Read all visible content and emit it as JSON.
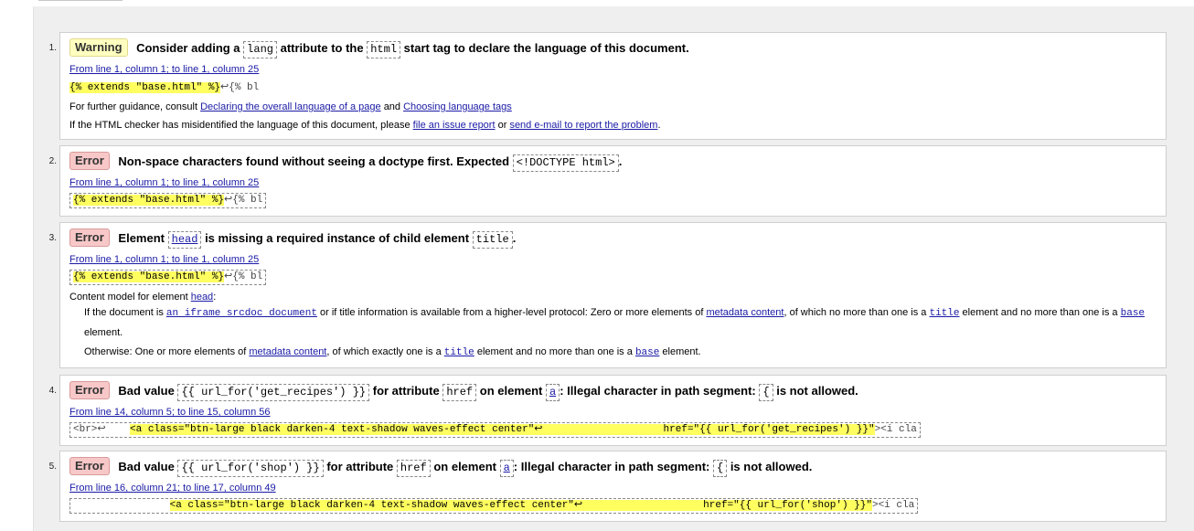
{
  "messages": [
    {
      "num": "1.",
      "type": "Warning",
      "t1": "Consider adding a",
      "c1": "lang",
      "t2": "attribute to the",
      "c2": "html",
      "t3": "start tag to declare the language of this document.",
      "location": "From line 1, column 1; to line 1, column 25",
      "extract_hl": "{% extends \"base.html\" %}",
      "extract_rest": "↩{% bl",
      "guidance_prefix": "For further guidance, consult",
      "guidance_link1": "Declaring the overall language of a page",
      "guidance_and": "and",
      "guidance_link2": "Choosing language tags",
      "misid_prefix": "If the HTML checker has misidentified the language of this document, please",
      "misid_link1": "file an issue report",
      "misid_or": "or",
      "misid_link2": "send e-mail to report the problem",
      "misid_end": "."
    },
    {
      "num": "2.",
      "type": "Error",
      "t1": "Non-space characters found without seeing a doctype first. Expected",
      "c1": "<!DOCTYPE html>",
      "t2": ".",
      "location": "From line 1, column 1; to line 1, column 25",
      "extract_hl": "{% extends \"base.html\" %}",
      "extract_rest": "↩{% bl"
    },
    {
      "num": "3.",
      "type": "Error",
      "t1": "Element",
      "c1": "head",
      "t2": "is missing a required instance of child element",
      "c2": "title",
      "t3": ".",
      "location": "From line 1, column 1; to line 1, column 25",
      "extract_hl": "{% extends \"base.html\" %}",
      "extract_rest": "↩{% bl",
      "cm_prefix": "Content model for element",
      "cm_link": "head",
      "cm_suffix": ":",
      "cm1_a": "If the document is",
      "cm1_link1": "an iframe srcdoc document",
      "cm1_b": "or if title information is available from a higher-level protocol: Zero or more elements of",
      "cm1_link2": "metadata content",
      "cm1_c": ", of which no more than one is a",
      "cm1_link3": "title",
      "cm1_d": "element and no more than one is a",
      "cm1_link4": "base",
      "cm1_e": "element.",
      "cm2_a": "Otherwise: One or more elements of",
      "cm2_link1": "metadata content",
      "cm2_b": ", of which exactly one is a",
      "cm2_link2": "title",
      "cm2_c": "element and no more than one is a",
      "cm2_link3": "base",
      "cm2_d": "element."
    },
    {
      "num": "4.",
      "type": "Error",
      "t1": "Bad value",
      "c1": "{{ url_for('get_recipes') }}",
      "t2": "for attribute",
      "c2": "href",
      "t3": "on element",
      "c3": "a",
      "t4": ": Illegal character in path segment:",
      "c4": "{",
      "t5": "is not allowed.",
      "location": "From line 14, column 5; to line 15, column 56",
      "extract_pre": "<br>↩    ",
      "extract_hl": "<a class=\"btn-large black darken-4 text-shadow waves-effect center\"↩                    href=\"{{ url_for('get_recipes') }}\"",
      "extract_rest": "><i cla"
    },
    {
      "num": "5.",
      "type": "Error",
      "t1": "Bad value",
      "c1": "{{ url_for('shop') }}",
      "t2": "for attribute",
      "c2": "href",
      "t3": "on element",
      "c3": "a",
      "t4": ": Illegal character in path segment:",
      "c4": "{",
      "t5": "is not allowed.",
      "location": "From line 16, column 21; to line 17, column 49",
      "extract_pre": "                ",
      "extract_hl": "<a class=\"btn-large black darken-4 text-shadow waves-effect center\"↩                    href=\"{{ url_for('shop') }}\"",
      "extract_rest": "><i cla"
    }
  ]
}
